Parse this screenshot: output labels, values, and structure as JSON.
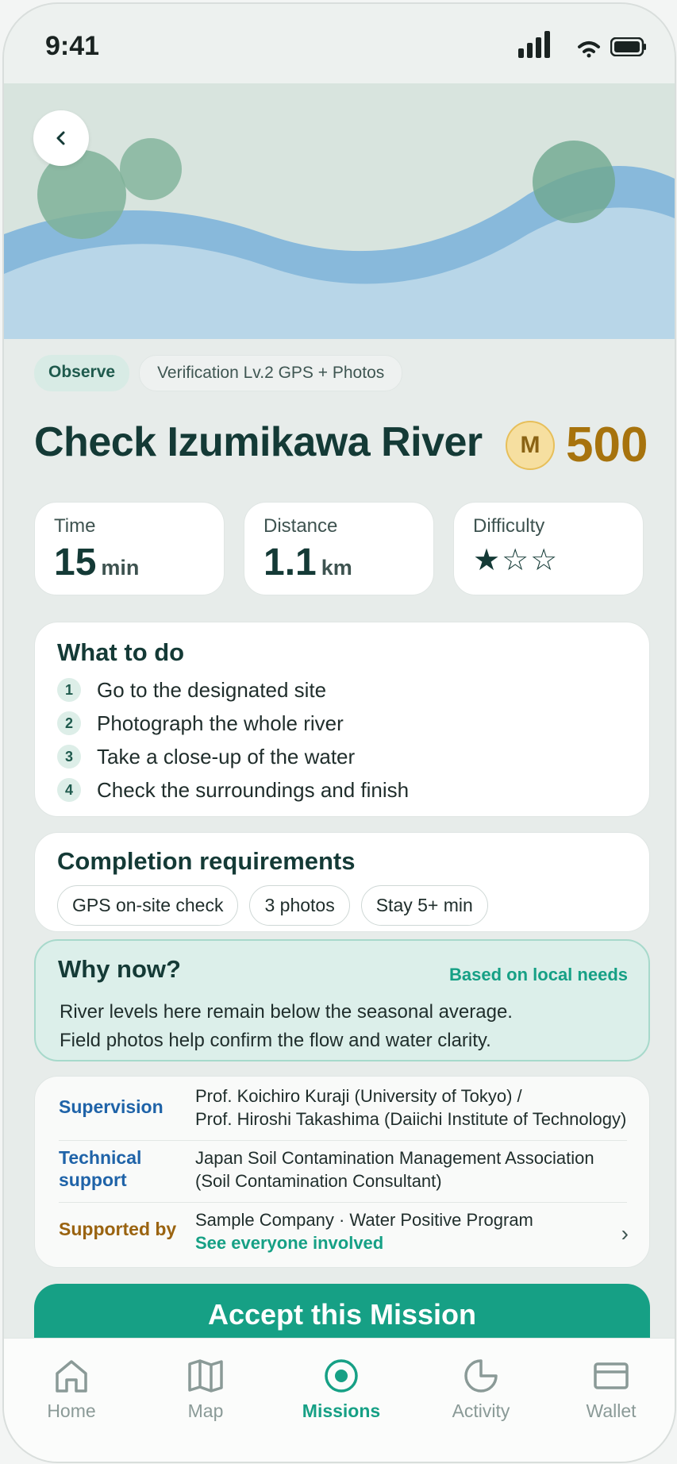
{
  "status_bar": {
    "time": "9:41"
  },
  "header": {
    "back_icon": "chevron-left-icon"
  },
  "mission": {
    "category": "Observe",
    "verification": "Verification Lv.2 GPS + Photos",
    "title": "Check Izumikawa River",
    "coin_symbol": "M",
    "reward": "500"
  },
  "stats": {
    "time": {
      "label": "Time",
      "value": "15",
      "unit": "min"
    },
    "distance": {
      "label": "Distance",
      "value": "1.1",
      "unit": "km"
    },
    "difficulty": {
      "label": "Difficulty",
      "stars_filled": 1,
      "stars_total": 3,
      "stars": "★☆☆"
    }
  },
  "what_to_do": {
    "heading": "What to do",
    "steps": [
      {
        "num": "1",
        "text": "Go to the designated site"
      },
      {
        "num": "2",
        "text": "Photograph the whole river"
      },
      {
        "num": "3",
        "text": "Take a close-up of the water"
      },
      {
        "num": "4",
        "text": "Check the surroundings and finish"
      }
    ]
  },
  "requirements": {
    "heading": "Completion requirements",
    "items": [
      "GPS on-site check",
      "3 photos",
      "Stay 5+ min"
    ]
  },
  "why_now": {
    "heading": "Why now?",
    "tag": "Based on local needs",
    "line1": "River levels here remain below the seasonal average.",
    "line2": "Field photos help confirm the flow and water clarity."
  },
  "credits": {
    "supervision_label": "Supervision",
    "supervision_line1": "Prof. Koichiro Kuraji (University of Tokyo) /",
    "supervision_line2": "Prof. Hiroshi Takashima (Daiichi Institute of Technology)",
    "technical_label_line1": "Technical",
    "technical_label_line2": "support",
    "technical_line1": "Japan Soil Contamination Management Association",
    "technical_line2": "(Soil Contamination Consultant)",
    "supported_label": "Supported by",
    "supported_line": "Sample Company  ·  Water Positive Program",
    "see_everyone": "See everyone involved"
  },
  "cta": {
    "label": "Accept this Mission"
  },
  "tabs": [
    {
      "label": "Home",
      "icon": "home-icon"
    },
    {
      "label": "Map",
      "icon": "map-icon"
    },
    {
      "label": "Missions",
      "icon": "target-icon",
      "active": true
    },
    {
      "label": "Activity",
      "icon": "pie-chart-icon"
    },
    {
      "label": "Wallet",
      "icon": "wallet-icon"
    }
  ],
  "colors": {
    "accent": "#16a085",
    "reward_gold": "#a7730d",
    "title_dark": "#143a36",
    "supervision_blue": "#1f63a8",
    "supported_brown": "#9a6310"
  }
}
